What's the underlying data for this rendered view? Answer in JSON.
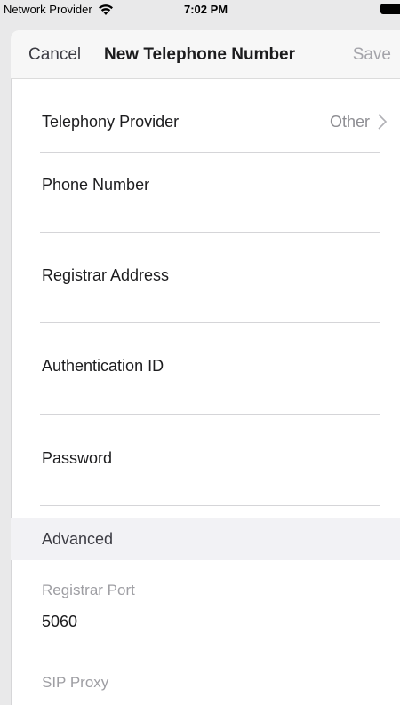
{
  "status_bar": {
    "carrier": "Network Provider",
    "time": "7:02 PM"
  },
  "nav": {
    "cancel_label": "Cancel",
    "title": "New Telephone Number",
    "save_label": "Save"
  },
  "form": {
    "telephony_provider": {
      "label": "Telephony Provider",
      "value": "Other"
    },
    "phone_number": {
      "label": "Phone Number",
      "value": ""
    },
    "registrar_address": {
      "label": "Registrar Address",
      "value": ""
    },
    "authentication_id": {
      "label": "Authentication ID",
      "value": ""
    },
    "password": {
      "label": "Password",
      "value": ""
    }
  },
  "advanced": {
    "header": "Advanced",
    "registrar_port": {
      "label": "Registrar Port",
      "value": "5060"
    },
    "sip_proxy": {
      "label": "SIP Proxy"
    }
  },
  "colors": {
    "background": "#e9e9ea",
    "nav_background": "#f7f7f7",
    "disabled_text": "#a4a4aa",
    "secondary_text": "#8e8e93"
  },
  "icons": [
    "wifi-icon",
    "battery-icon",
    "chevron-right-icon"
  ]
}
